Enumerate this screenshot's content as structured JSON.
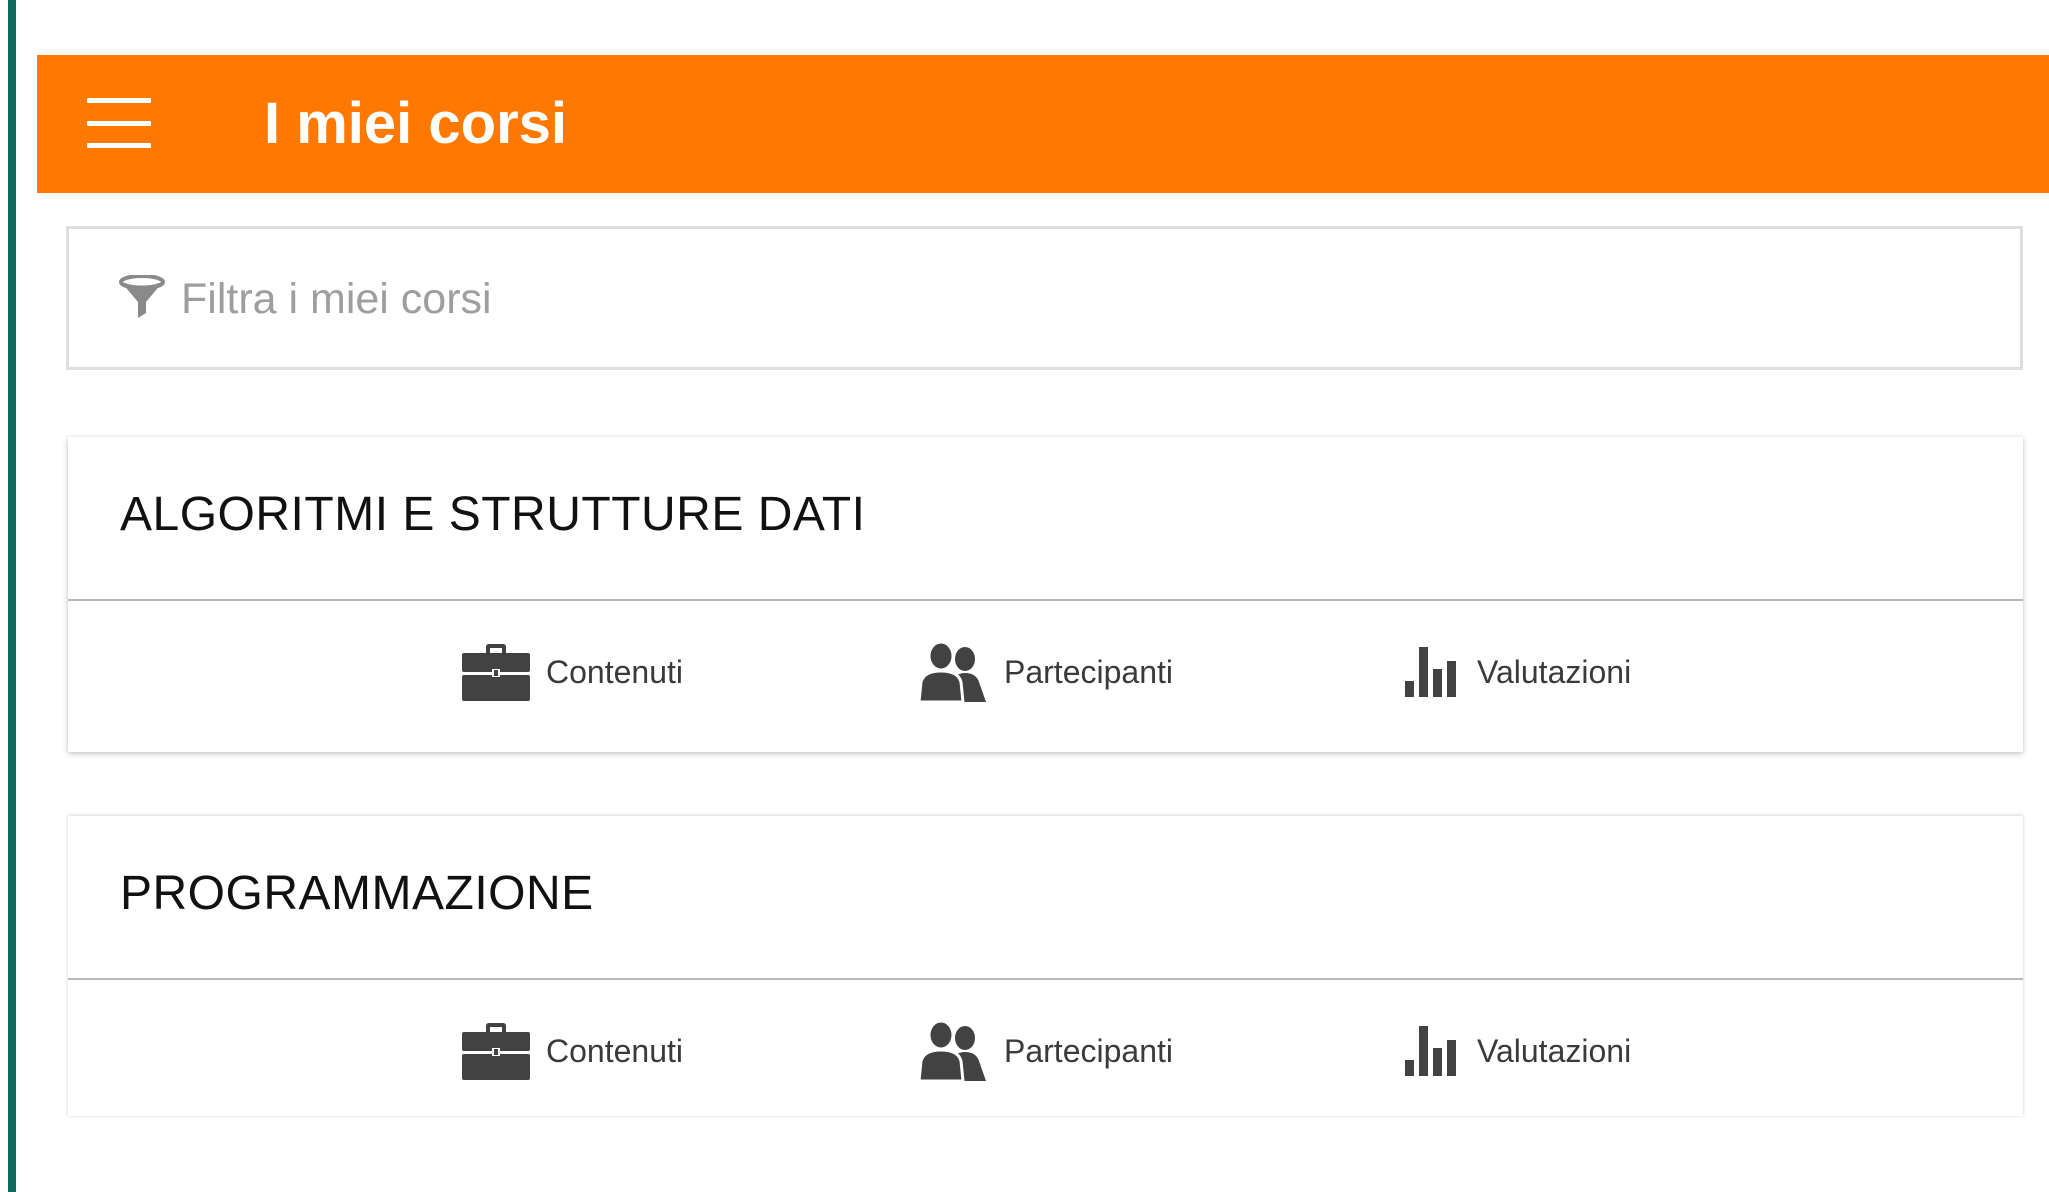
{
  "appbar": {
    "title": "I miei corsi",
    "background_color": "#ff7800",
    "menu_icon": "hamburger-menu-icon"
  },
  "filter": {
    "placeholder": "Filtra i miei corsi",
    "value": "",
    "icon": "funnel-filter-icon"
  },
  "courses": [
    {
      "title": "ALGORITMI E STRUTTURE DATI",
      "actions": [
        {
          "label": "Contenuti",
          "icon": "briefcase-icon"
        },
        {
          "label": "Partecipanti",
          "icon": "people-icon"
        },
        {
          "label": "Valutazioni",
          "icon": "bar-chart-icon"
        }
      ]
    },
    {
      "title": "PROGRAMMAZIONE",
      "actions": [
        {
          "label": "Contenuti",
          "icon": "briefcase-icon"
        },
        {
          "label": "Partecipanti",
          "icon": "people-icon"
        },
        {
          "label": "Valutazioni",
          "icon": "bar-chart-icon"
        }
      ]
    }
  ],
  "colors": {
    "accent": "#ff7800",
    "side_rule": "#0f6b5c",
    "icon": "#424242"
  }
}
